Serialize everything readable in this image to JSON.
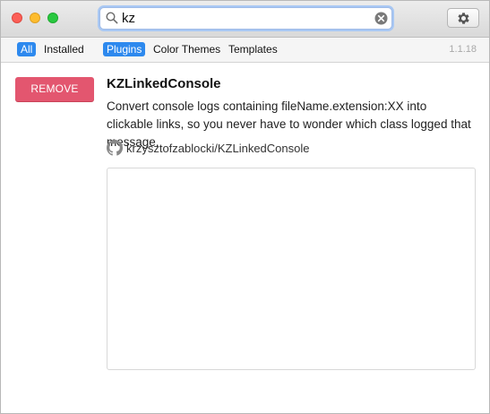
{
  "search": {
    "value": "kz",
    "placeholder": ""
  },
  "icons": {
    "search": "search-icon",
    "clear": "clear-icon",
    "gear": "gear-icon",
    "github": "github-icon"
  },
  "filters": {
    "all": "All",
    "installed": "Installed",
    "plugins": "Plugins",
    "color_themes": "Color Themes",
    "templates": "Templates"
  },
  "version": "1.1.18",
  "plugin": {
    "action_label": "REMOVE",
    "name": "KZLinkedConsole",
    "description": "Convert console logs containing fileName.extension:XX into clickable links, so you never have to wonder which class logged that message.",
    "repo": "krzysztofzablocki/KZLinkedConsole"
  },
  "colors": {
    "accent": "#2d89ee",
    "remove": "#e3566f",
    "close": "#fc5f57",
    "minimize": "#fdbc2e",
    "maximize": "#29c840"
  }
}
